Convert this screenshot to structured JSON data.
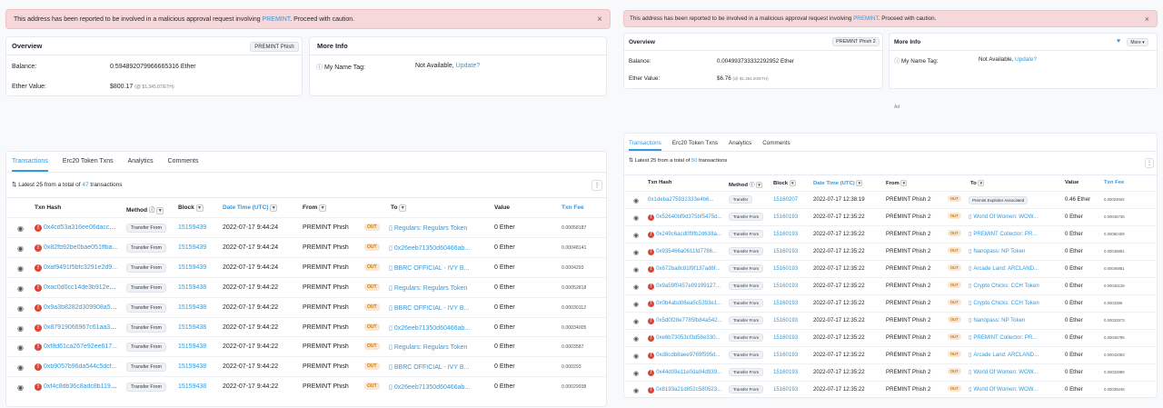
{
  "left": {
    "alert": {
      "pre": "This address has been reported to be involved in a malicious approval request involving ",
      "link": "PREMINT",
      "post": ". Proceed with caution.",
      "close": "×"
    },
    "overview": {
      "title": "Overview",
      "tag": "PREMINT Phish",
      "balance_label": "Balance:",
      "balance_value": "0.594892079966665316 Ether",
      "ether_value_label": "Ether Value:",
      "ether_value": "$800.17",
      "ether_value_sub": "(@ $1,345.07/ETH)"
    },
    "more_info": {
      "title": "More Info",
      "tag_label": "My Name Tag:",
      "tag_value": "Not Available,",
      "update": "Update?"
    },
    "tabs": [
      "Transactions",
      "Erc20 Token Txns",
      "Analytics",
      "Comments"
    ],
    "summary": {
      "pre": "Latest 25 from a total of ",
      "count": "47",
      "post": " transactions"
    },
    "columns": {
      "hash": "Txn Hash",
      "method": "Method",
      "block": "Block",
      "age": "Date Time (UTC)",
      "from": "From",
      "to": "To",
      "value": "Value",
      "fee": "Txn Fee"
    },
    "rows": [
      {
        "hash": "0x4cd53a316ee06dacc8...",
        "method": "Transfer From",
        "block": "15159439",
        "time": "2022-07-17 9:44:24",
        "from": "PREMINT Phish",
        "dir": "OUT",
        "to": "Regulars: Regulars Token",
        "value": "0 Ether",
        "fee": "0.00058187"
      },
      {
        "hash": "0x82fb92be0bae051ffba...",
        "method": "Transfer From",
        "block": "15159439",
        "time": "2022-07-17 9:44:24",
        "from": "PREMINT Phish",
        "dir": "OUT",
        "to": "0x26eeb71350d60466ab...",
        "value": "0 Ether",
        "fee": "0.00048141"
      },
      {
        "hash": "0xaf9491f5bfc3291e2d9...",
        "method": "Transfer From",
        "block": "15159439",
        "time": "2022-07-17 9:44:24",
        "from": "PREMINT Phish",
        "dir": "OUT",
        "to": "BBRC OFFICIAL - IVY B...",
        "value": "0 Ether",
        "fee": "0.0004293"
      },
      {
        "hash": "0xac0d0cc14de3b912e3...",
        "method": "Transfer From",
        "block": "15159438",
        "time": "2022-07-17 9:44:22",
        "from": "PREMINT Phish",
        "dir": "OUT",
        "to": "Regulars: Regulars Token",
        "value": "0 Ether",
        "fee": "0.00052818"
      },
      {
        "hash": "0x9a3b8282d309908a5b...",
        "method": "Transfer From",
        "block": "15159438",
        "time": "2022-07-17 9:44:22",
        "from": "PREMINT Phish",
        "dir": "OUT",
        "to": "BBRC OFFICIAL - IVY B...",
        "value": "0 Ether",
        "fee": "0.00030112"
      },
      {
        "hash": "0x87919066967c61aa3a...",
        "method": "Transfer From",
        "block": "15159438",
        "time": "2022-07-17 9:44:22",
        "from": "PREMINT Phish",
        "dir": "OUT",
        "to": "0x26eeb71350d60466ab...",
        "value": "0 Ether",
        "fee": "0.00034005"
      },
      {
        "hash": "0xf8d61ca267e92ee617...",
        "method": "Transfer From",
        "block": "15159438",
        "time": "2022-07-17 9:44:22",
        "from": "PREMINT Phish",
        "dir": "OUT",
        "to": "Regulars: Regulars Token",
        "value": "0 Ether",
        "fee": "0.0003587"
      },
      {
        "hash": "0xb9057b96da544c5dcf...",
        "method": "Transfer From",
        "block": "15159438",
        "time": "2022-07-17 9:44:22",
        "from": "PREMINT Phish",
        "dir": "OUT",
        "to": "BBRC OFFICIAL - IVY B...",
        "value": "0 Ether",
        "fee": "0.000293"
      },
      {
        "hash": "0xf4c8db36c8adc8b119c...",
        "method": "Transfer From",
        "block": "15159438",
        "time": "2022-07-17 9:44:22",
        "from": "PREMINT Phish",
        "dir": "OUT",
        "to": "0x26eeb71350d60466ab...",
        "value": "0 Ether",
        "fee": "0.00029938"
      }
    ]
  },
  "right": {
    "alert": {
      "pre": "This address has been reported to be involved in a malicious approval request involving ",
      "link": "PREMINT",
      "post": ". Proceed with caution.",
      "close": "×"
    },
    "overview": {
      "title": "Overview",
      "tag": "PREMINT Phish 2",
      "balance_label": "Balance:",
      "balance_value": "0.004993733332292952 Ether",
      "ether_value_label": "Ether Value:",
      "ether_value": "$6.76",
      "ether_value_sub": "(@ $1,354.20/ETH)"
    },
    "more_info": {
      "title": "More Info",
      "more": "More",
      "tag_label": "My Name Tag:",
      "tag_value": "Not Available,",
      "update": "Update?"
    },
    "ad": "Ad",
    "tabs": [
      "Transactions",
      "Erc20 Token Txns",
      "Analytics",
      "Comments"
    ],
    "summary": {
      "pre": "Latest 25 from a total of ",
      "count": "50",
      "post": " transactions"
    },
    "columns": {
      "hash": "Txn Hash",
      "method": "Method",
      "block": "Block",
      "age": "Date Time (UTC)",
      "from": "From",
      "to": "To",
      "value": "Value",
      "fee": "Txn Fee"
    },
    "rows": [
      {
        "hash": "0x1deba275932333e4b6...",
        "method": "Transfer",
        "block": "15160207",
        "time": "2022-07-17 12:38:19",
        "from": "PREMINT Phish 2",
        "dir": "OUT",
        "to": "Premint Exploiter Associated",
        "value": "0.46 Ether",
        "fee": "0.00024602",
        "err": false,
        "to_tag": true
      },
      {
        "hash": "0x52640bf9d375bf5475d...",
        "method": "Transfer From",
        "block": "15160193",
        "time": "2022-07-17 12:35:22",
        "from": "PREMINT Phish 2",
        "dir": "OUT",
        "to": "World Of Women: WOW...",
        "value": "0 Ether",
        "fee": "0.00046736",
        "err": true
      },
      {
        "hash": "0x249c6acd0f9fb2d638a...",
        "method": "Transfer From",
        "block": "15160193",
        "time": "2022-07-17 12:35:22",
        "from": "PREMINT Phish 2",
        "dir": "OUT",
        "to": "PREMINT Collector: PR...",
        "value": "0 Ether",
        "fee": "0.00050409",
        "err": true
      },
      {
        "hash": "0x935466a0611fd7786...",
        "method": "Transfer From",
        "block": "15160193",
        "time": "2022-07-17 12:35:22",
        "from": "PREMINT Phish 2",
        "dir": "OUT",
        "to": "Nanopass: NP Token",
        "value": "0 Ether",
        "fee": "0.00046881",
        "err": true
      },
      {
        "hash": "0x672ba8c81f9f137ad6f...",
        "method": "Transfer From",
        "block": "15160193",
        "time": "2022-07-17 12:35:22",
        "from": "PREMINT Phish 2",
        "dir": "OUT",
        "to": "Arcade Land: ARCLAND...",
        "value": "0 Ether",
        "fee": "0.00046881",
        "err": true
      },
      {
        "hash": "0x9a59f0457e09199127...",
        "method": "Transfer From",
        "block": "15160193",
        "time": "2022-07-17 12:35:22",
        "from": "PREMINT Phish 2",
        "dir": "OUT",
        "to": "Crypto Chicks: CCH Token",
        "value": "0 Ether",
        "fee": "0.00046128",
        "err": true
      },
      {
        "hash": "0x0b4abd06ea5c5393e1...",
        "method": "Transfer From",
        "block": "15160193",
        "time": "2022-07-17 12:35:22",
        "from": "PREMINT Phish 2",
        "dir": "OUT",
        "to": "Crypto Chicks: CCH Token",
        "value": "0 Ether",
        "fee": "0.0003386",
        "err": true
      },
      {
        "hash": "0x5d0f28e7785fb84a542...",
        "method": "Transfer From",
        "block": "15160193",
        "time": "2022-07-17 12:35:22",
        "from": "PREMINT Phish 2",
        "dir": "OUT",
        "to": "Nanopass: NP Token",
        "value": "0 Ether",
        "fee": "0.00032973",
        "err": true
      },
      {
        "hash": "0xe6b73053cf3d58e330...",
        "method": "Transfer From",
        "block": "15160193",
        "time": "2022-07-17 12:35:22",
        "from": "PREMINT Phish 2",
        "dir": "OUT",
        "to": "PREMINT Collector: PR...",
        "value": "0 Ether",
        "fee": "0.00045786",
        "err": true
      },
      {
        "hash": "0xd8cdb8aee9769f595d...",
        "method": "Transfer From",
        "block": "15160193",
        "time": "2022-07-17 12:35:22",
        "from": "PREMINT Phish 2",
        "dir": "OUT",
        "to": "Arcade Land: ARCLAND...",
        "value": "0 Ether",
        "fee": "0.00042083",
        "err": true
      },
      {
        "hash": "0x44d09e11e0da04d939...",
        "method": "Transfer From",
        "block": "15160193",
        "time": "2022-07-17 12:35:22",
        "from": "PREMINT Phish 2",
        "dir": "OUT",
        "to": "World Of Women: WOW...",
        "value": "0 Ether",
        "fee": "0.00032989",
        "err": true
      },
      {
        "hash": "0x8193a21d852c580523...",
        "method": "Transfer From",
        "block": "15160193",
        "time": "2022-07-17 12:35:22",
        "from": "PREMINT Phish 2",
        "dir": "OUT",
        "to": "World Of Women: WOW...",
        "value": "0 Ether",
        "fee": "0.00039245",
        "err": true
      }
    ]
  }
}
